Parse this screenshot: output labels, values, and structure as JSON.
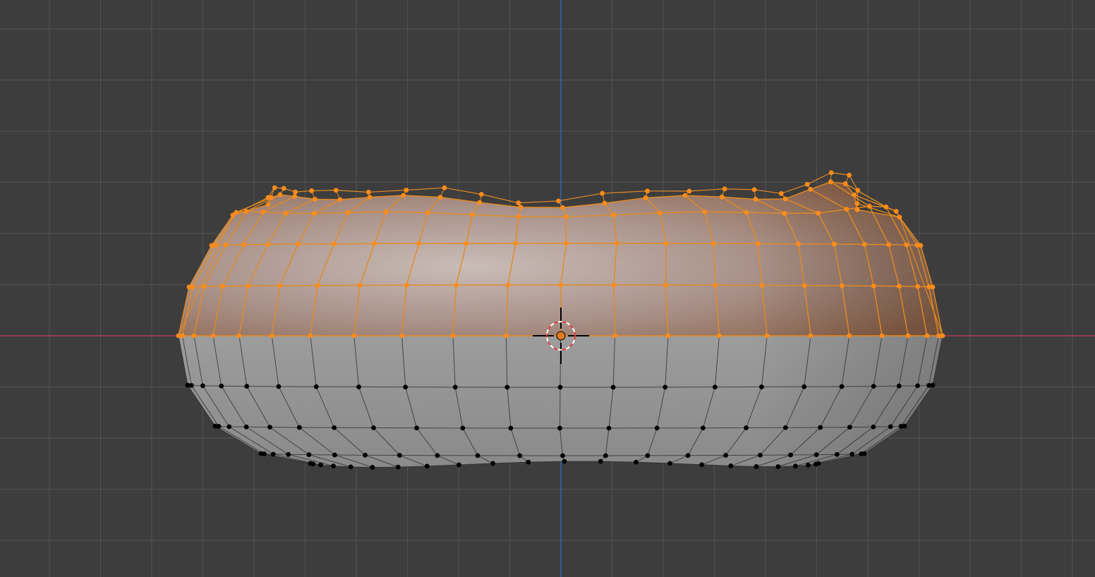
{
  "viewport": {
    "mode": "edit-mode",
    "view": "front-orthographic",
    "grid_visible": true
  },
  "colors": {
    "background": "#3d3d3d",
    "grid_line": "#525252",
    "x_axis": "#b03a50",
    "z_axis": "#2e67b5",
    "selected_vertex": "#ff8c1a",
    "selected_edge": "#e38a22",
    "unselected_vertex": "#000000",
    "unselected_edge": "#2a2a2a",
    "mesh_surface": "#a9a9a9",
    "origin_dot": "#e07a1f",
    "cursor_ring_red": "#d8383b",
    "cursor_ring_white": "#ffffff"
  },
  "mesh": {
    "object": "blob-mesh",
    "selection": "upper-half",
    "ring_count": 7
  },
  "icons": {
    "cursor": "3d-cursor-icon",
    "origin": "object-origin-icon"
  }
}
